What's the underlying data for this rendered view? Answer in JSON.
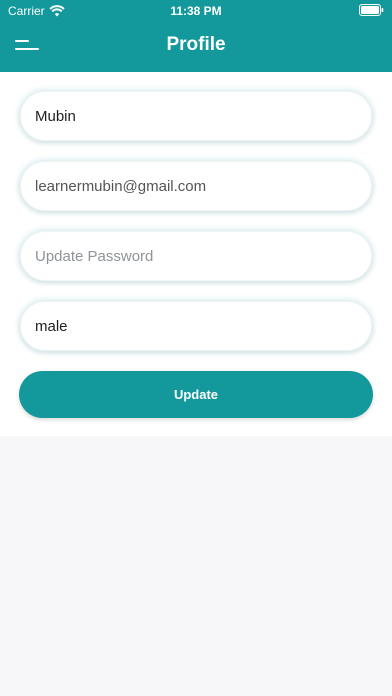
{
  "status_bar": {
    "carrier": "Carrier",
    "time": "11:38 PM",
    "wifi_icon": "wifi-icon",
    "battery_icon": "battery-icon"
  },
  "header": {
    "title": "Profile",
    "menu_icon": "menu-icon",
    "background": "#13989b"
  },
  "form": {
    "name": {
      "value": "Mubin"
    },
    "email": {
      "value": "learnermubin@gmail.com"
    },
    "password": {
      "value": "",
      "placeholder": "Update Password"
    },
    "gender": {
      "value": "male"
    },
    "update_label": "Update"
  },
  "colors": {
    "accent": "#13989b",
    "page_background": "#f7f7fa",
    "card_background": "#ffffff"
  }
}
